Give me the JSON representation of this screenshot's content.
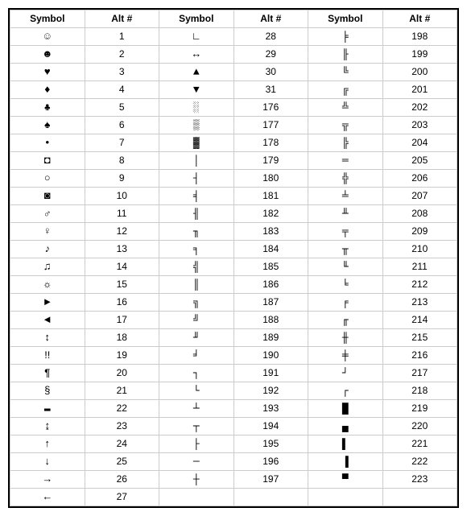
{
  "headers": {
    "symbol": "Symbol",
    "alt": "Alt #"
  },
  "rows": [
    {
      "s1": "☺",
      "a1": "1",
      "s2": "∟",
      "a2": "28",
      "s3": "╞",
      "a3": "198"
    },
    {
      "s1": "☻",
      "a1": "2",
      "s2": "↔",
      "a2": "29",
      "s3": "╟",
      "a3": "199"
    },
    {
      "s1": "♥",
      "a1": "3",
      "s2": "▲",
      "a2": "30",
      "s3": "╚",
      "a3": "200"
    },
    {
      "s1": "♦",
      "a1": "4",
      "s2": "▼",
      "a2": "31",
      "s3": "╔",
      "a3": "201"
    },
    {
      "s1": "♣",
      "a1": "5",
      "s2": "░",
      "a2": "176",
      "s3": "╩",
      "a3": "202"
    },
    {
      "s1": "♠",
      "a1": "6",
      "s2": "▒",
      "a2": "177",
      "s3": "╦",
      "a3": "203"
    },
    {
      "s1": "•",
      "a1": "7",
      "s2": "▓",
      "a2": "178",
      "s3": "╠",
      "a3": "204"
    },
    {
      "s1": "◘",
      "a1": "8",
      "s2": "│",
      "a2": "179",
      "s3": "═",
      "a3": "205"
    },
    {
      "s1": "○",
      "a1": "9",
      "s2": "┤",
      "a2": "180",
      "s3": "╬",
      "a3": "206"
    },
    {
      "s1": "◙",
      "a1": "10",
      "s2": "╡",
      "a2": "181",
      "s3": "╧",
      "a3": "207"
    },
    {
      "s1": "♂",
      "a1": "11",
      "s2": "╢",
      "a2": "182",
      "s3": "╨",
      "a3": "208"
    },
    {
      "s1": "♀",
      "a1": "12",
      "s2": "╖",
      "a2": "183",
      "s3": "╤",
      "a3": "209"
    },
    {
      "s1": "♪",
      "a1": "13",
      "s2": "╕",
      "a2": "184",
      "s3": "╥",
      "a3": "210"
    },
    {
      "s1": "♫",
      "a1": "14",
      "s2": "╣",
      "a2": "185",
      "s3": "╙",
      "a3": "211"
    },
    {
      "s1": "☼",
      "a1": "15",
      "s2": "║",
      "a2": "186",
      "s3": "╘",
      "a3": "212"
    },
    {
      "s1": "►",
      "a1": "16",
      "s2": "╗",
      "a2": "187",
      "s3": "╒",
      "a3": "213"
    },
    {
      "s1": "◄",
      "a1": "17",
      "s2": "╝",
      "a2": "188",
      "s3": "╓",
      "a3": "214"
    },
    {
      "s1": "↕",
      "a1": "18",
      "s2": "╜",
      "a2": "189",
      "s3": "╫",
      "a3": "215"
    },
    {
      "s1": "‼",
      "a1": "19",
      "s2": "╛",
      "a2": "190",
      "s3": "╪",
      "a3": "216"
    },
    {
      "s1": "¶",
      "a1": "20",
      "s2": "┐",
      "a2": "191",
      "s3": "┘",
      "a3": "217"
    },
    {
      "s1": "§",
      "a1": "21",
      "s2": "└",
      "a2": "192",
      "s3": "┌",
      "a3": "218"
    },
    {
      "s1": "▬",
      "a1": "22",
      "s2": "┴",
      "a2": "193",
      "s3": "█",
      "a3": "219"
    },
    {
      "s1": "↨",
      "a1": "23",
      "s2": "┬",
      "a2": "194",
      "s3": "▄",
      "a3": "220"
    },
    {
      "s1": "↑",
      "a1": "24",
      "s2": "├",
      "a2": "195",
      "s3": "▌",
      "a3": "221"
    },
    {
      "s1": "↓",
      "a1": "25",
      "s2": "─",
      "a2": "196",
      "s3": "▐",
      "a3": "222"
    },
    {
      "s1": "→",
      "a1": "26",
      "s2": "┼",
      "a2": "197",
      "s3": "▀",
      "a3": "223"
    },
    {
      "s1": "←",
      "a1": "27",
      "s2": "",
      "a2": "",
      "s3": "",
      "a3": ""
    }
  ]
}
